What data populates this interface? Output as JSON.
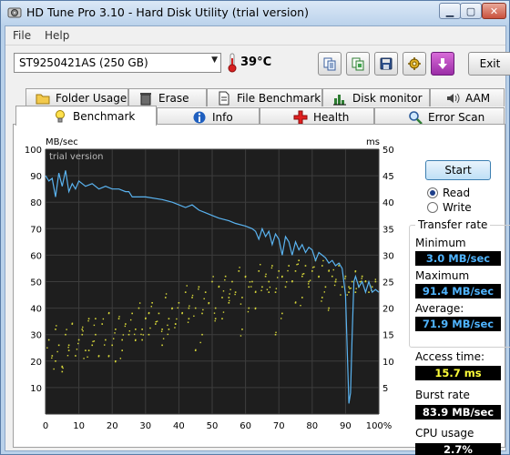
{
  "window": {
    "title": "HD Tune Pro 3.10 - Hard Disk Utility (trial version)"
  },
  "menu": {
    "file": "File",
    "help": "Help"
  },
  "toolbar": {
    "drive": "ST9250421AS (250 GB)",
    "temperature": "39°C",
    "exit_label": "Exit",
    "icons": [
      "copy-text-icon",
      "copy-screen-icon",
      "save-icon",
      "options-icon",
      "download-icon"
    ]
  },
  "tabs": {
    "row_top": [
      "Folder Usage",
      "Erase",
      "File Benchmark",
      "Disk monitor",
      "AAM"
    ],
    "row_bottom": [
      "Benchmark",
      "Info",
      "Health",
      "Error Scan"
    ],
    "active": "Benchmark"
  },
  "benchmark": {
    "start_label": "Start",
    "read_label": "Read",
    "write_label": "Write",
    "mode": "Read",
    "transfer_rate_title": "Transfer rate",
    "minimum_label": "Minimum",
    "minimum_value": "3.0 MB/sec",
    "maximum_label": "Maximum",
    "maximum_value": "91.4 MB/sec",
    "average_label": "Average:",
    "average_value": "71.9 MB/sec",
    "access_label": "Access time:",
    "access_value": "15.7 ms",
    "burst_label": "Burst rate",
    "burst_value": "83.9 MB/sec",
    "cpu_label": "CPU usage",
    "cpu_value": "2.7%"
  },
  "chart_data": {
    "type": "line",
    "watermark": "trial version",
    "left_unit": "MB/sec",
    "right_unit": "ms",
    "x_ticks": [
      "0",
      "10",
      "20",
      "30",
      "40",
      "50",
      "60",
      "70",
      "80",
      "90",
      "100%"
    ],
    "y_left_ticks": [
      "100",
      "90",
      "80",
      "70",
      "60",
      "50",
      "40",
      "30",
      "20",
      "10"
    ],
    "y_right_ticks": [
      "50",
      "45",
      "40",
      "35",
      "30",
      "25",
      "20",
      "15",
      "10",
      "5"
    ],
    "xlim": [
      0,
      100
    ],
    "ylim_left": [
      0,
      100
    ],
    "ylim_right": [
      0,
      50
    ],
    "grid": true,
    "colors": {
      "background": "#1e1e1e",
      "grid": "#3d3d3d",
      "transfer": "#5ab3f0",
      "access": "#d8d83a"
    },
    "series": [
      {
        "name": "",
        "axis": "left",
        "color": "#5ab3f0",
        "x": [
          0,
          1,
          2,
          3,
          4,
          5,
          6,
          7,
          8,
          9,
          10,
          12,
          14,
          16,
          18,
          20,
          22,
          24,
          25,
          26,
          30,
          35,
          38,
          40,
          42,
          44,
          46,
          48,
          50,
          52,
          55,
          57,
          60,
          62,
          63,
          64,
          65,
          66,
          67,
          68,
          69,
          70,
          71,
          72,
          73,
          74,
          75,
          76,
          77,
          78,
          79,
          80,
          81,
          82,
          83,
          84,
          85,
          86,
          87,
          88,
          89,
          90,
          90.5,
          91,
          91.5,
          92,
          92.5,
          93,
          94,
          95,
          96,
          97,
          98,
          99,
          100
        ],
        "y": [
          90,
          88,
          89,
          82,
          91,
          86,
          92,
          84,
          87,
          85,
          88,
          86,
          87,
          85,
          86,
          85,
          85,
          84,
          84,
          82,
          82,
          81,
          80,
          79,
          78,
          79,
          77,
          76,
          75,
          74,
          73,
          72,
          71,
          70,
          69,
          66,
          70,
          67,
          69,
          64,
          68,
          66,
          60,
          67,
          65,
          60,
          65,
          62,
          64,
          61,
          63,
          62,
          58,
          61,
          60,
          59,
          57,
          58,
          56,
          57,
          55,
          45,
          25,
          4,
          8,
          30,
          50,
          52,
          48,
          50,
          46,
          50,
          46,
          47,
          46
        ]
      },
      {
        "name": "",
        "axis": "right",
        "type": "scatter",
        "color": "#d8d83a",
        "x": [
          1,
          2,
          3,
          4,
          5,
          6,
          7,
          8,
          9,
          10,
          11,
          12,
          13,
          14,
          15,
          16,
          17,
          18,
          19,
          20,
          21,
          22,
          23,
          24,
          25,
          26,
          27,
          28,
          29,
          30,
          31,
          32,
          33,
          34,
          35,
          36,
          37,
          38,
          39,
          40,
          41,
          42,
          43,
          44,
          45,
          46,
          47,
          48,
          49,
          50,
          51,
          52,
          53,
          54,
          55,
          56,
          57,
          58,
          59,
          60,
          61,
          62,
          63,
          64,
          65,
          66,
          67,
          68,
          69,
          70,
          71,
          72,
          73,
          74,
          75,
          76,
          77,
          78,
          79,
          80,
          81,
          82,
          83,
          84,
          85,
          86,
          87,
          88,
          89,
          90,
          91,
          92,
          93,
          94,
          95,
          96,
          97,
          98,
          99,
          3,
          7,
          11,
          15,
          19,
          23,
          27,
          31,
          35,
          39,
          43,
          47,
          51,
          55,
          59,
          63,
          67,
          71,
          75,
          79,
          83,
          87,
          91,
          95,
          5,
          13,
          21,
          29,
          37,
          45,
          53,
          61,
          69,
          77,
          85,
          93
        ],
        "y": [
          14,
          11,
          16,
          13,
          9,
          15,
          12,
          17,
          11,
          14,
          16,
          12,
          18,
          13,
          15,
          11,
          17,
          14,
          19,
          13,
          16,
          18,
          12,
          17,
          15,
          19,
          14,
          20,
          16,
          18,
          15,
          21,
          17,
          19,
          16,
          22,
          18,
          20,
          17,
          21,
          19,
          23,
          18,
          22,
          20,
          24,
          19,
          23,
          21,
          25,
          20,
          24,
          22,
          26,
          21,
          25,
          23,
          27,
          22,
          26,
          24,
          25,
          23,
          27,
          24,
          26,
          25,
          28,
          23,
          27,
          26,
          24,
          28,
          25,
          27,
          29,
          26,
          28,
          25,
          27,
          29,
          26,
          28,
          24,
          27,
          26,
          25,
          28,
          24,
          26,
          23,
          25,
          27,
          24,
          26,
          25,
          23,
          24,
          25,
          10,
          13,
          15,
          18,
          11,
          14,
          16,
          19,
          13,
          17,
          20,
          15,
          18,
          22,
          16,
          20,
          23,
          19,
          21,
          24,
          22,
          25,
          24,
          26,
          8,
          12,
          10,
          14,
          16,
          12,
          18,
          20,
          15,
          22,
          20,
          23
        ]
      }
    ]
  }
}
